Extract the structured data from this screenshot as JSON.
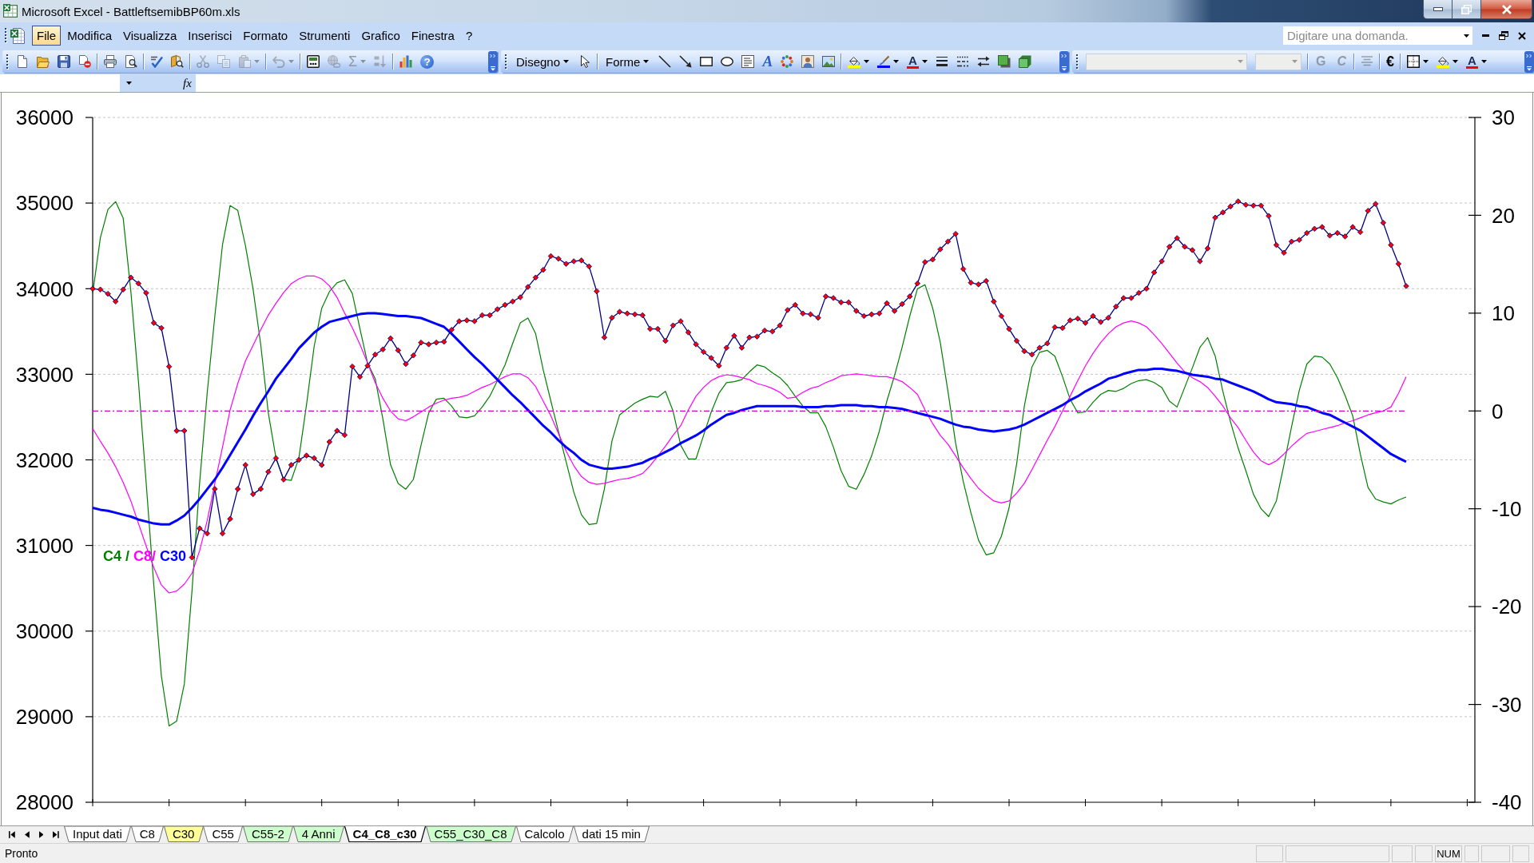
{
  "window": {
    "title": "Microsoft Excel - BattleftsemibBP60m.xls"
  },
  "menu_bar": {
    "items": [
      {
        "label": "File",
        "selected": true
      },
      {
        "label": "Modifica",
        "selected": false
      },
      {
        "label": "Visualizza",
        "selected": false
      },
      {
        "label": "Inserisci",
        "selected": false
      },
      {
        "label": "Formato",
        "selected": false
      },
      {
        "label": "Strumenti",
        "selected": false
      },
      {
        "label": "Grafico",
        "selected": false
      },
      {
        "label": "Finestra",
        "selected": false
      },
      {
        "label": "?",
        "selected": false
      }
    ],
    "question_box": {
      "placeholder": "Digitare una domanda."
    }
  },
  "toolbars": [
    {
      "groups": [
        [
          {
            "kind": "icon",
            "disabled": false
          },
          {
            "kind": "icon",
            "disabled": false
          },
          {
            "kind": "icon",
            "disabled": false
          },
          {
            "kind": "icon",
            "disabled": false
          }
        ],
        [
          {
            "kind": "icon",
            "disabled": false
          },
          {
            "kind": "icon",
            "disabled": false
          }
        ],
        [
          {
            "kind": "icon",
            "disabled": false
          },
          {
            "kind": "icon",
            "disabled": false
          }
        ],
        [
          {
            "kind": "icon",
            "disabled": true
          },
          {
            "kind": "icon",
            "disabled": true
          },
          {
            "kind": "icon_menu",
            "disabled": true
          }
        ],
        [
          {
            "kind": "icon_menu",
            "disabled": true
          }
        ],
        [
          {
            "kind": "icon",
            "disabled": false
          },
          {
            "kind": "icon",
            "disabled": true
          },
          {
            "kind": "glyph_menu",
            "label": "Σ",
            "disabled": true
          },
          {
            "kind": "icon",
            "disabled": true
          }
        ],
        [
          {
            "kind": "icon",
            "disabled": false
          },
          {
            "kind": "glyph",
            "label": "?",
            "disabled": false
          }
        ]
      ]
    },
    {
      "groups": [
        [
          {
            "kind": "text_menu",
            "label": "Disegno",
            "disabled": false
          },
          {
            "kind": "icon",
            "disabled": false
          }
        ],
        [
          {
            "kind": "text_menu",
            "label": "Forme",
            "disabled": false
          },
          {
            "kind": "icon",
            "disabled": false
          },
          {
            "kind": "icon",
            "disabled": false
          },
          {
            "kind": "icon",
            "disabled": false
          },
          {
            "kind": "icon",
            "disabled": false
          },
          {
            "kind": "icon",
            "disabled": false
          },
          {
            "kind": "glyph",
            "label": "A",
            "disabled": false
          },
          {
            "kind": "icon",
            "disabled": false
          },
          {
            "kind": "icon",
            "disabled": false
          },
          {
            "kind": "icon",
            "disabled": false
          }
        ],
        [
          {
            "kind": "icon_menu",
            "disabled": false
          },
          {
            "kind": "icon_menu",
            "disabled": false
          },
          {
            "kind": "glyph_menu",
            "label": "A",
            "disabled": false
          },
          {
            "kind": "icon",
            "disabled": false
          },
          {
            "kind": "icon",
            "disabled": false
          },
          {
            "kind": "icon",
            "disabled": false
          },
          {
            "kind": "icon",
            "disabled": false
          },
          {
            "kind": "icon",
            "disabled": false
          }
        ]
      ]
    },
    {
      "groups": [
        [
          {
            "kind": "combo",
            "disabled": true
          },
          {
            "kind": "combo",
            "disabled": true
          }
        ],
        [
          {
            "kind": "glyph",
            "label": "G",
            "disabled": true
          },
          {
            "kind": "glyph",
            "label": "C",
            "disabled": true
          }
        ],
        [
          {
            "kind": "icon",
            "disabled": true
          }
        ],
        [
          {
            "kind": "glyph",
            "label": "€",
            "disabled": false
          }
        ],
        [
          {
            "kind": "icon_menu",
            "disabled": false
          },
          {
            "kind": "icon_menu",
            "disabled": false
          },
          {
            "kind": "glyph_menu",
            "label": "A",
            "disabled": false
          }
        ]
      ]
    }
  ],
  "formula_bar": {
    "function_button": {
      "label": "fx"
    }
  },
  "chart": {
    "legend": [
      {
        "text": "C4 /",
        "color": "#008000"
      },
      {
        "text": "C8/",
        "color": "#ff00ff"
      },
      {
        "text": "C30",
        "color": "#0000ff"
      }
    ],
    "chart_data": {
      "type": "line",
      "grid": true,
      "ylim": [
        28000,
        36000
      ],
      "yticks": [
        28000,
        29000,
        30000,
        31000,
        32000,
        33000,
        34000,
        35000,
        36000
      ],
      "y2lim": [
        -40,
        30
      ],
      "y2ticks": [
        -40,
        -30,
        -20,
        -10,
        0,
        10,
        20,
        30
      ],
      "series": [
        {
          "color": "#008000",
          "axis": "y2",
          "values": [
            12.0,
            17.7,
            20.6,
            21.4,
            19.7,
            12.2,
            3.0,
            -7.3,
            -17.8,
            -27.1,
            -32.2,
            -31.7,
            -27.9,
            -18.4,
            -7.4,
            1.9,
            9.7,
            17.0,
            21.0,
            20.5,
            16.9,
            12.5,
            6.8,
            -0.2,
            -4.8,
            -7.0,
            -7.1,
            -4.8,
            0.6,
            6.6,
            10.5,
            12.2,
            13.1,
            13.4,
            12.0,
            8.4,
            4.9,
            3.3,
            -0.8,
            -5.5,
            -7.4,
            -8.0,
            -7.0,
            -3.5,
            -0.2,
            1.2,
            1.3,
            0.5,
            -0.6,
            -0.7,
            -0.5,
            0.4,
            1.5,
            3.1,
            4.7,
            6.9,
            9.0,
            9.5,
            7.9,
            4.2,
            1.0,
            -2.1,
            -5.2,
            -8.3,
            -10.6,
            -11.6,
            -11.5,
            -8.0,
            -3.1,
            -0.4,
            0.2,
            0.8,
            1.2,
            1.5,
            1.4,
            2.0,
            0.0,
            -3.5,
            -4.9,
            -4.9,
            -2.5,
            -0.1,
            1.8,
            2.9,
            3.0,
            3.2,
            4.0,
            4.7,
            4.5,
            3.9,
            3.4,
            2.6,
            1.5,
            0.5,
            -0.2,
            -0.2,
            -1.6,
            -3.7,
            -6.1,
            -7.7,
            -8.0,
            -6.5,
            -4.6,
            -2.1,
            1.0,
            3.6,
            6.5,
            9.7,
            12.5,
            12.9,
            10.5,
            7.0,
            2.0,
            -3.3,
            -7.2,
            -10.4,
            -13.2,
            -14.7,
            -14.5,
            -12.8,
            -9.9,
            -5.4,
            0.5,
            4.5,
            6.0,
            6.2,
            5.6,
            3.5,
            1.2,
            -0.2,
            -0.1,
            0.9,
            1.7,
            2.1,
            2.0,
            2.3,
            2.8,
            3.1,
            3.2,
            2.9,
            2.4,
            1.0,
            0.4,
            2.4,
            4.4,
            6.5,
            7.5,
            5.6,
            2.0,
            -1.1,
            -3.8,
            -6.1,
            -8.5,
            -10.0,
            -10.8,
            -9.2,
            -5.5,
            -1.6,
            2.1,
            4.8,
            5.6,
            5.5,
            4.8,
            3.4,
            1.6,
            -0.5,
            -4.4,
            -7.8,
            -9.0,
            -9.3,
            -9.5,
            -9.1,
            -8.8
          ]
        },
        {
          "color": "#ff00ff",
          "axis": "y2",
          "values": [
            -1.8,
            -3.1,
            -4.3,
            -5.7,
            -7.3,
            -9.2,
            -11.5,
            -13.8,
            -16.0,
            -17.8,
            -18.6,
            -18.4,
            -17.7,
            -16.6,
            -14.3,
            -11.2,
            -7.4,
            -3.7,
            0.1,
            2.8,
            5.1,
            6.7,
            8.3,
            9.8,
            11.0,
            12.1,
            13.0,
            13.5,
            13.8,
            13.8,
            13.5,
            12.8,
            11.6,
            10.0,
            8.5,
            6.8,
            4.9,
            2.9,
            1.3,
            0.0,
            -0.8,
            -1.0,
            -0.6,
            -0.1,
            0.4,
            0.8,
            1.1,
            1.3,
            1.4,
            1.6,
            2.0,
            2.4,
            2.7,
            3.1,
            3.5,
            3.8,
            3.8,
            3.4,
            2.5,
            1.0,
            -0.5,
            -2.3,
            -4.1,
            -5.6,
            -6.7,
            -7.3,
            -7.5,
            -7.4,
            -7.2,
            -7.0,
            -6.9,
            -6.7,
            -6.4,
            -5.6,
            -4.6,
            -3.6,
            -2.5,
            -1.5,
            0.1,
            1.5,
            2.4,
            3.1,
            3.5,
            3.7,
            3.6,
            3.4,
            3.2,
            2.8,
            2.6,
            2.3,
            1.9,
            1.3,
            1.4,
            1.9,
            2.3,
            2.5,
            2.9,
            3.2,
            3.6,
            3.7,
            3.8,
            3.7,
            3.6,
            3.5,
            3.5,
            3.3,
            3.0,
            2.4,
            1.7,
            0.1,
            -1.3,
            -2.5,
            -3.4,
            -4.6,
            -5.8,
            -6.9,
            -7.9,
            -8.6,
            -9.2,
            -9.4,
            -9.2,
            -8.4,
            -7.4,
            -6.0,
            -4.5,
            -3.0,
            -1.6,
            0.0,
            1.5,
            3.1,
            4.6,
            5.9,
            7.0,
            7.9,
            8.6,
            9.0,
            9.2,
            9.0,
            8.6,
            7.8,
            6.9,
            5.9,
            4.9,
            4.0,
            3.4,
            3.0,
            2.4,
            1.5,
            0.5,
            -0.7,
            -1.7,
            -3.0,
            -4.2,
            -5.1,
            -5.5,
            -5.1,
            -4.4,
            -3.6,
            -2.9,
            -2.3,
            -2.1,
            -1.9,
            -1.7,
            -1.5,
            -1.2,
            -1.0,
            -0.7,
            -0.4,
            -0.2,
            0.0,
            0.4,
            1.8,
            3.5
          ]
        },
        {
          "color": "#0000ff",
          "axis": "y2",
          "values": [
            -9.9,
            -10.1,
            -10.2,
            -10.4,
            -10.6,
            -10.8,
            -11.1,
            -11.3,
            -11.5,
            -11.6,
            -11.6,
            -11.2,
            -10.7,
            -9.9,
            -9.0,
            -8.0,
            -7.0,
            -5.8,
            -4.5,
            -3.2,
            -1.9,
            -0.5,
            0.8,
            2.0,
            3.3,
            4.3,
            5.3,
            6.4,
            7.2,
            8.0,
            8.6,
            9.1,
            9.3,
            9.5,
            9.7,
            9.9,
            10.0,
            10.0,
            9.9,
            9.8,
            9.7,
            9.7,
            9.6,
            9.5,
            9.2,
            8.9,
            8.6,
            7.9,
            7.1,
            6.3,
            5.5,
            4.8,
            4.0,
            3.2,
            2.4,
            1.6,
            0.9,
            0.1,
            -0.7,
            -1.5,
            -2.2,
            -3.0,
            -3.7,
            -4.3,
            -5.0,
            -5.5,
            -5.7,
            -5.9,
            -5.9,
            -5.8,
            -5.7,
            -5.5,
            -5.3,
            -4.9,
            -4.6,
            -4.2,
            -3.8,
            -3.3,
            -2.9,
            -2.5,
            -2.0,
            -1.4,
            -0.9,
            -0.4,
            -0.2,
            0.1,
            0.3,
            0.5,
            0.5,
            0.5,
            0.5,
            0.5,
            0.5,
            0.4,
            0.4,
            0.4,
            0.5,
            0.5,
            0.6,
            0.6,
            0.6,
            0.5,
            0.5,
            0.4,
            0.4,
            0.3,
            0.2,
            0.0,
            -0.2,
            -0.4,
            -0.6,
            -0.8,
            -1.1,
            -1.4,
            -1.6,
            -1.7,
            -1.9,
            -2.0,
            -2.1,
            -2.0,
            -1.9,
            -1.7,
            -1.4,
            -1.0,
            -0.6,
            -0.2,
            0.2,
            0.6,
            1.1,
            1.5,
            2.0,
            2.4,
            2.8,
            3.3,
            3.5,
            3.8,
            4.0,
            4.2,
            4.2,
            4.3,
            4.3,
            4.2,
            4.1,
            3.9,
            3.7,
            3.6,
            3.5,
            3.3,
            3.2,
            2.9,
            2.6,
            2.3,
            2.0,
            1.6,
            1.2,
            0.9,
            0.8,
            0.7,
            0.5,
            0.4,
            0.1,
            -0.2,
            -0.4,
            -0.8,
            -1.2,
            -1.6,
            -2.0,
            -2.6,
            -3.2,
            -3.8,
            -4.4,
            -4.8,
            -5.2
          ]
        },
        {
          "color": "#cc00cc",
          "axis": "y2",
          "line_style": "dashdot",
          "values": [
            0,
            0,
            0,
            0,
            0,
            0,
            0,
            0,
            0,
            0,
            0,
            0,
            0,
            0,
            0,
            0,
            0,
            0,
            0,
            0,
            0,
            0,
            0,
            0,
            0,
            0,
            0,
            0,
            0,
            0,
            0,
            0,
            0,
            0,
            0,
            0,
            0,
            0,
            0,
            0,
            0,
            0,
            0,
            0,
            0,
            0,
            0,
            0,
            0,
            0,
            0,
            0,
            0,
            0,
            0,
            0,
            0,
            0,
            0,
            0,
            0,
            0,
            0,
            0,
            0,
            0,
            0,
            0,
            0,
            0,
            0,
            0,
            0,
            0,
            0,
            0,
            0,
            0,
            0,
            0,
            0,
            0,
            0,
            0,
            0,
            0,
            0,
            0,
            0,
            0,
            0,
            0,
            0,
            0,
            0,
            0,
            0,
            0,
            0,
            0,
            0,
            0,
            0,
            0,
            0,
            0,
            0,
            0,
            0,
            0,
            0,
            0,
            0,
            0,
            0,
            0,
            0,
            0,
            0,
            0,
            0,
            0,
            0,
            0,
            0,
            0,
            0,
            0,
            0,
            0,
            0,
            0,
            0,
            0,
            0,
            0,
            0,
            0,
            0,
            0,
            0,
            0,
            0,
            0,
            0,
            0,
            0,
            0,
            0,
            0,
            0,
            0,
            0,
            0,
            0,
            0,
            0,
            0,
            0,
            0,
            0,
            0,
            0,
            0,
            0,
            0,
            0,
            0,
            0,
            0,
            0,
            0,
            0
          ]
        },
        {
          "color": "#000080",
          "marker": "diamond",
          "values": [
            34000,
            33990,
            33940,
            33850,
            33990,
            34130,
            34060,
            33950,
            33600,
            33540,
            33090,
            32340,
            32340,
            30860,
            31200,
            31140,
            31660,
            31140,
            31310,
            31660,
            31940,
            31600,
            31660,
            31860,
            32020,
            31770,
            31940,
            32000,
            32050,
            32020,
            31940,
            32210,
            32340,
            32290,
            33090,
            32970,
            33100,
            33230,
            33290,
            33420,
            33280,
            33120,
            33220,
            33370,
            33350,
            33370,
            33380,
            33520,
            33620,
            33630,
            33620,
            33690,
            33690,
            33760,
            33810,
            33850,
            33900,
            34020,
            34130,
            34220,
            34380,
            34350,
            34290,
            34320,
            34330,
            34260,
            33970,
            33430,
            33660,
            33730,
            33710,
            33700,
            33690,
            33530,
            33530,
            33390,
            33570,
            33620,
            33490,
            33350,
            33260,
            33190,
            33100,
            33310,
            33450,
            33310,
            33430,
            33440,
            33510,
            33500,
            33570,
            33750,
            33810,
            33710,
            33700,
            33660,
            33910,
            33890,
            33840,
            33840,
            33740,
            33680,
            33700,
            33710,
            33830,
            33740,
            33820,
            33910,
            34060,
            34310,
            34340,
            34460,
            34550,
            34640,
            34230,
            34070,
            34050,
            34090,
            33850,
            33680,
            33530,
            33390,
            33270,
            33230,
            33310,
            33360,
            33550,
            33540,
            33630,
            33650,
            33600,
            33680,
            33610,
            33660,
            33790,
            33890,
            33890,
            33950,
            34000,
            34190,
            34320,
            34490,
            34590,
            34490,
            34450,
            34320,
            34470,
            34830,
            34890,
            34960,
            35020,
            34980,
            34970,
            34970,
            34850,
            34510,
            34420,
            34550,
            34570,
            34650,
            34700,
            34720,
            34620,
            34650,
            34610,
            34720,
            34660,
            34910,
            34990,
            34770,
            34510,
            34290,
            34030
          ]
        }
      ]
    }
  },
  "sheet_tabs": [
    {
      "label": "Input dati",
      "color": "#ffffff",
      "selected": false
    },
    {
      "label": "C8",
      "color": "#ffffff",
      "selected": false
    },
    {
      "label": "C30",
      "color": "#ffff99",
      "selected": false
    },
    {
      "label": "C55",
      "color": "#ffffff",
      "selected": false
    },
    {
      "label": "C55-2",
      "color": "#ccffcc",
      "selected": false
    },
    {
      "label": "4 Anni",
      "color": "#ccffcc",
      "selected": false
    },
    {
      "label": "C4_C8_c30",
      "color": "#ffffff",
      "selected": true
    },
    {
      "label": "C55_C30_C8",
      "color": "#ccffcc",
      "selected": false
    },
    {
      "label": "Calcolo",
      "color": "#ffffff",
      "selected": false
    },
    {
      "label": "dati 15 min",
      "color": "#ffffff",
      "selected": false
    }
  ],
  "status_bar": {
    "text": "Pronto",
    "indicator": "NUM"
  }
}
